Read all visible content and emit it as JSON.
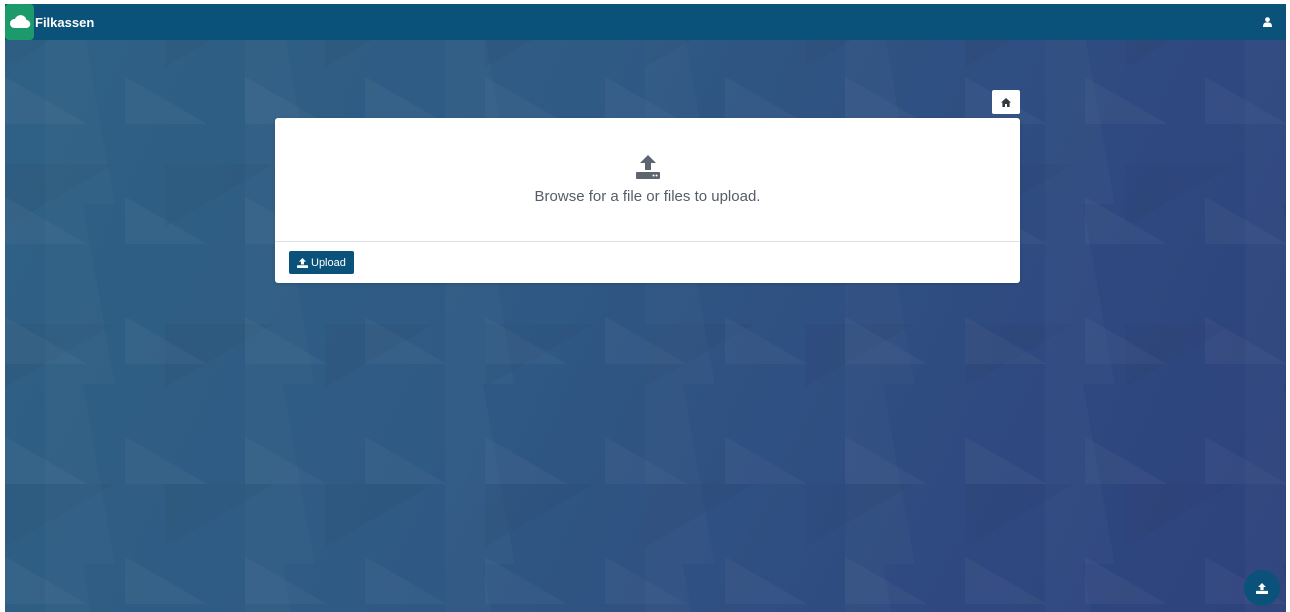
{
  "app": {
    "title": "Filkassen"
  },
  "header": {
    "logo_icon": "cloud-icon",
    "user_icon": "user-icon"
  },
  "toolbar": {
    "home_icon": "home-icon"
  },
  "uploader": {
    "icon": "upload-tray-icon",
    "prompt": "Browse for a file or files to upload.",
    "upload_button_label": "Upload",
    "upload_button_icon": "upload-icon"
  },
  "fab": {
    "icon": "upload-icon"
  },
  "colors": {
    "header_bg": "#0b527a",
    "logo_bg": "#1d9a6c",
    "primary_button": "#0b527a",
    "prompt_text": "#555d66",
    "background_start": "#2f6185",
    "background_end": "#2e427b"
  }
}
